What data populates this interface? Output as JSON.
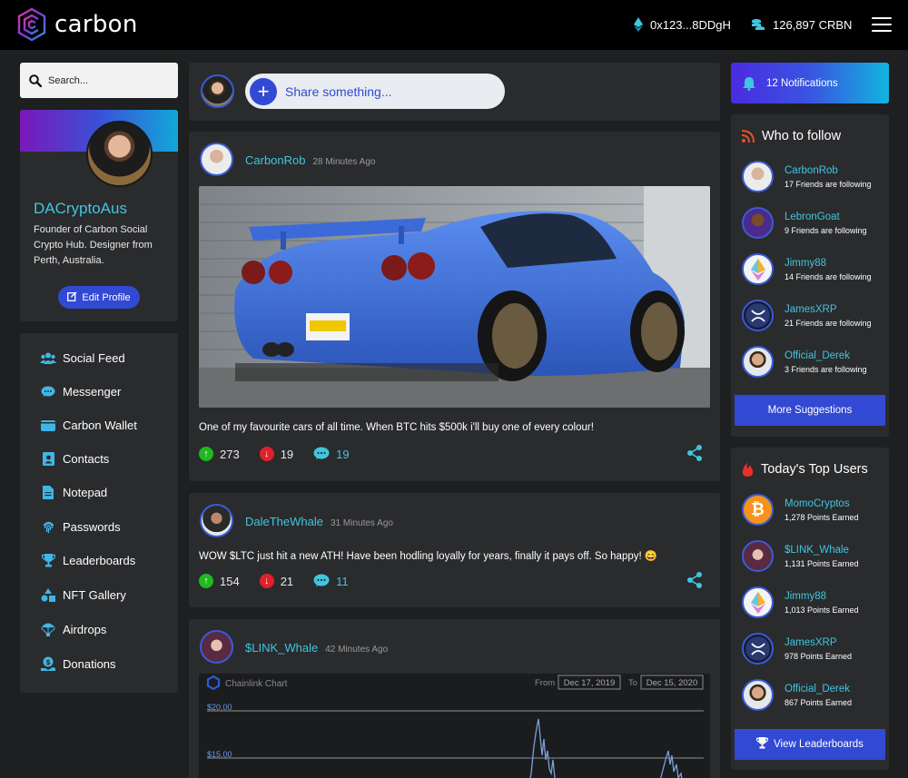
{
  "brand": {
    "name": "carbon"
  },
  "topbar": {
    "wallet": "0x123...8DDgH",
    "balance": "126,897 CRBN"
  },
  "search": {
    "placeholder": "Search..."
  },
  "profile": {
    "name": "DACryptoAus",
    "bio": "Founder of Carbon Social Crypto Hub. Designer from Perth, Australia.",
    "edit_label": "Edit Profile"
  },
  "nav": {
    "items": [
      {
        "label": "Social Feed",
        "icon": "users-icon"
      },
      {
        "label": "Messenger",
        "icon": "chat-icon"
      },
      {
        "label": "Carbon Wallet",
        "icon": "wallet-icon"
      },
      {
        "label": "Contacts",
        "icon": "contact-icon"
      },
      {
        "label": "Notepad",
        "icon": "document-icon"
      },
      {
        "label": "Passwords",
        "icon": "fingerprint-icon"
      },
      {
        "label": "Leaderboards",
        "icon": "trophy-icon"
      },
      {
        "label": "NFT Gallery",
        "icon": "shapes-icon"
      },
      {
        "label": "Airdrops",
        "icon": "parachute-icon"
      },
      {
        "label": "Donations",
        "icon": "donation-icon"
      }
    ]
  },
  "composer": {
    "placeholder": "Share something..."
  },
  "posts": [
    {
      "author": "CarbonRob",
      "time": "28 Minutes Ago",
      "text": "One of my favourite cars of all time. When BTC hits $500k i'll buy one of every colour!",
      "upvotes": "273",
      "downvotes": "19",
      "comments": "19"
    },
    {
      "author": "DaleTheWhale",
      "time": "31 Minutes Ago",
      "text": "WOW $LTC just hit a new ATH! Have been hodling loyally for years, finally it pays off. So happy! 😄",
      "upvotes": "154",
      "downvotes": "21",
      "comments": "11"
    },
    {
      "author": "$LINK_Whale",
      "time": "42 Minutes Ago",
      "chart": {
        "title": "Chainlink Chart",
        "from_label": "From",
        "from_value": "Dec 17, 2019",
        "to_label": "To",
        "to_value": "Dec 15, 2020",
        "tick_20": "$20.00",
        "tick_15": "$15.00"
      }
    }
  ],
  "notifications": {
    "label": "12 Notifications"
  },
  "who_to_follow": {
    "title": "Who to follow",
    "people": [
      {
        "name": "CarbonRob",
        "sub": "17 Friends are following"
      },
      {
        "name": "LebronGoat",
        "sub": "9 Friends are following"
      },
      {
        "name": "Jimmy88",
        "sub": "14 Friends are following"
      },
      {
        "name": "JamesXRP",
        "sub": "21 Friends are following"
      },
      {
        "name": "Official_Derek",
        "sub": "3 Friends are following"
      }
    ],
    "button": "More Suggestions"
  },
  "top_users": {
    "title": "Today's Top Users",
    "people": [
      {
        "name": "MomoCryptos",
        "sub": "1,278 Points Earned"
      },
      {
        "name": "$LINK_Whale",
        "sub": "1,131 Points Earned"
      },
      {
        "name": "Jimmy88",
        "sub": "1,013 Points Earned"
      },
      {
        "name": "JamesXRP",
        "sub": "978 Points Earned"
      },
      {
        "name": "Official_Derek",
        "sub": "867 Points Earned"
      }
    ],
    "button": "View Leaderboards"
  },
  "colors": {
    "accent": "#3fc6e0",
    "primary": "#3249d3",
    "panel": "#2a2b2d",
    "background": "#1e1f21"
  }
}
